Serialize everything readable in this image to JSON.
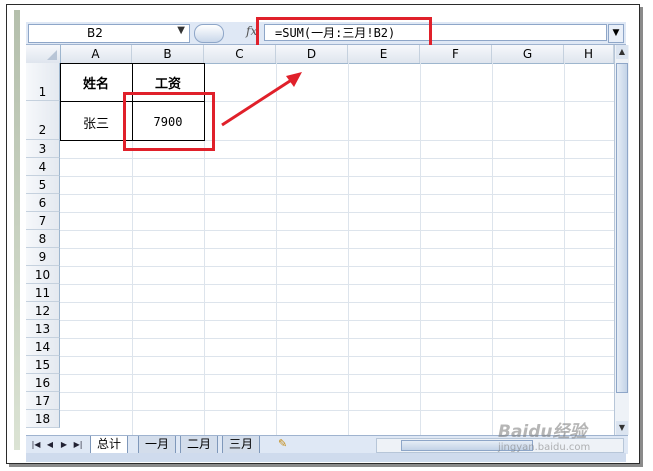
{
  "formula_bar": {
    "name_box": "B2",
    "fx_label": "fx",
    "formula": "=SUM(一月:三月!B2)"
  },
  "grid": {
    "columns": [
      "A",
      "B",
      "C",
      "D",
      "E",
      "F",
      "G",
      "H"
    ],
    "rows": [
      "1",
      "2",
      "3",
      "4",
      "5",
      "6",
      "7",
      "8",
      "9",
      "10",
      "11",
      "12",
      "13",
      "14",
      "15",
      "16",
      "17",
      "18"
    ],
    "cells": {
      "A1": "姓名",
      "B1": "工资",
      "A2": "张三",
      "B2": "7900"
    }
  },
  "sheet_tabs": {
    "tabs": [
      "总计",
      "一月",
      "二月",
      "三月"
    ],
    "active": "总计"
  },
  "watermark": {
    "logo": "Baidu经验",
    "url": "jingyan.baidu.com"
  },
  "colors": {
    "highlight": "#e0202a",
    "header_bg": "#dfe5ee",
    "ribbon_bg": "#dfe8f5"
  }
}
